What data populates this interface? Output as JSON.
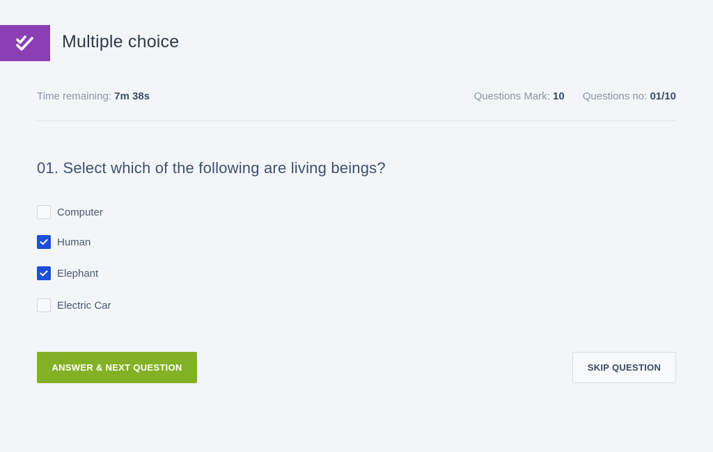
{
  "header": {
    "title": "Multiple choice",
    "badge_icon": "double-check-icon",
    "badge_color": "#8b3fb4"
  },
  "meta": {
    "time_label": "Time remaining:",
    "time_value": "7m 38s",
    "mark_label": "Questions Mark:",
    "mark_value": "10",
    "number_label": "Questions no:",
    "number_value": "01/10"
  },
  "question": {
    "text": "01. Select which of the following are living beings?",
    "options": [
      {
        "label": "Computer",
        "checked": false
      },
      {
        "label": "Human",
        "checked": true
      },
      {
        "label": "Elephant",
        "checked": true
      },
      {
        "label": "Electric Car",
        "checked": false
      }
    ]
  },
  "actions": {
    "answer_label": "ANSWER & NEXT QUESTION",
    "skip_label": "SKIP QUESTION",
    "answer_color": "#82b126",
    "check_color": "#1e4fd8"
  }
}
